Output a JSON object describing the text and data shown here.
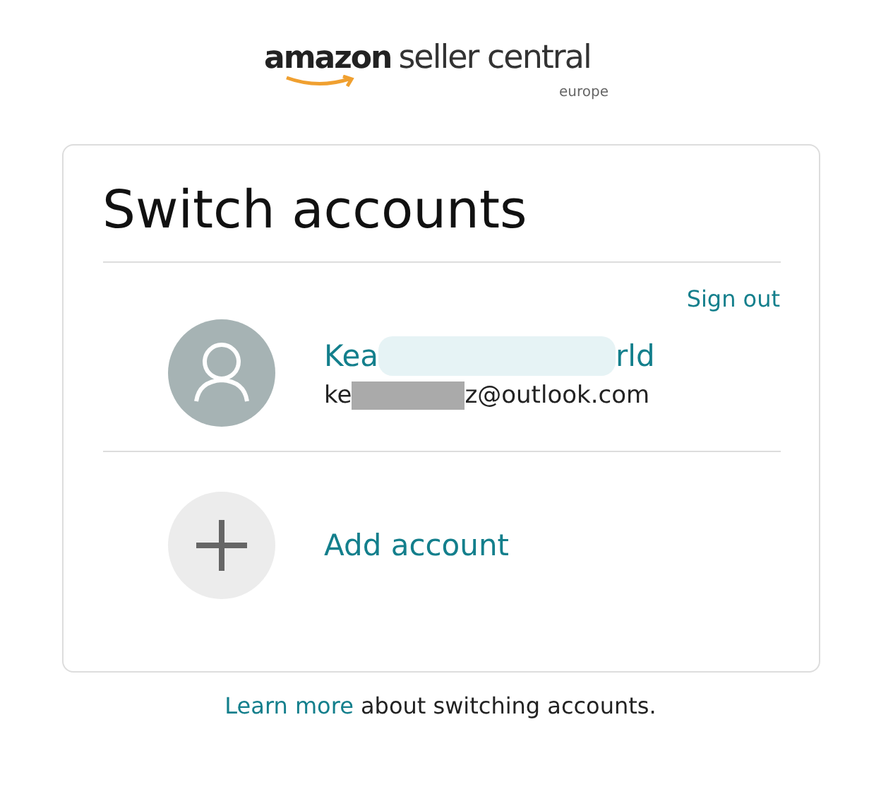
{
  "logo": {
    "brand": "amazon",
    "product": "seller central",
    "region": "europe"
  },
  "card": {
    "title": "Switch accounts",
    "sign_out": "Sign out",
    "account": {
      "name_start": "Kea",
      "name_end": "rld",
      "email_start": "ke",
      "email_end": "z@outlook.com",
      "redacted": true
    },
    "add_account": "Add account"
  },
  "footer": {
    "link": "Learn more",
    "text": "about switching accounts."
  }
}
